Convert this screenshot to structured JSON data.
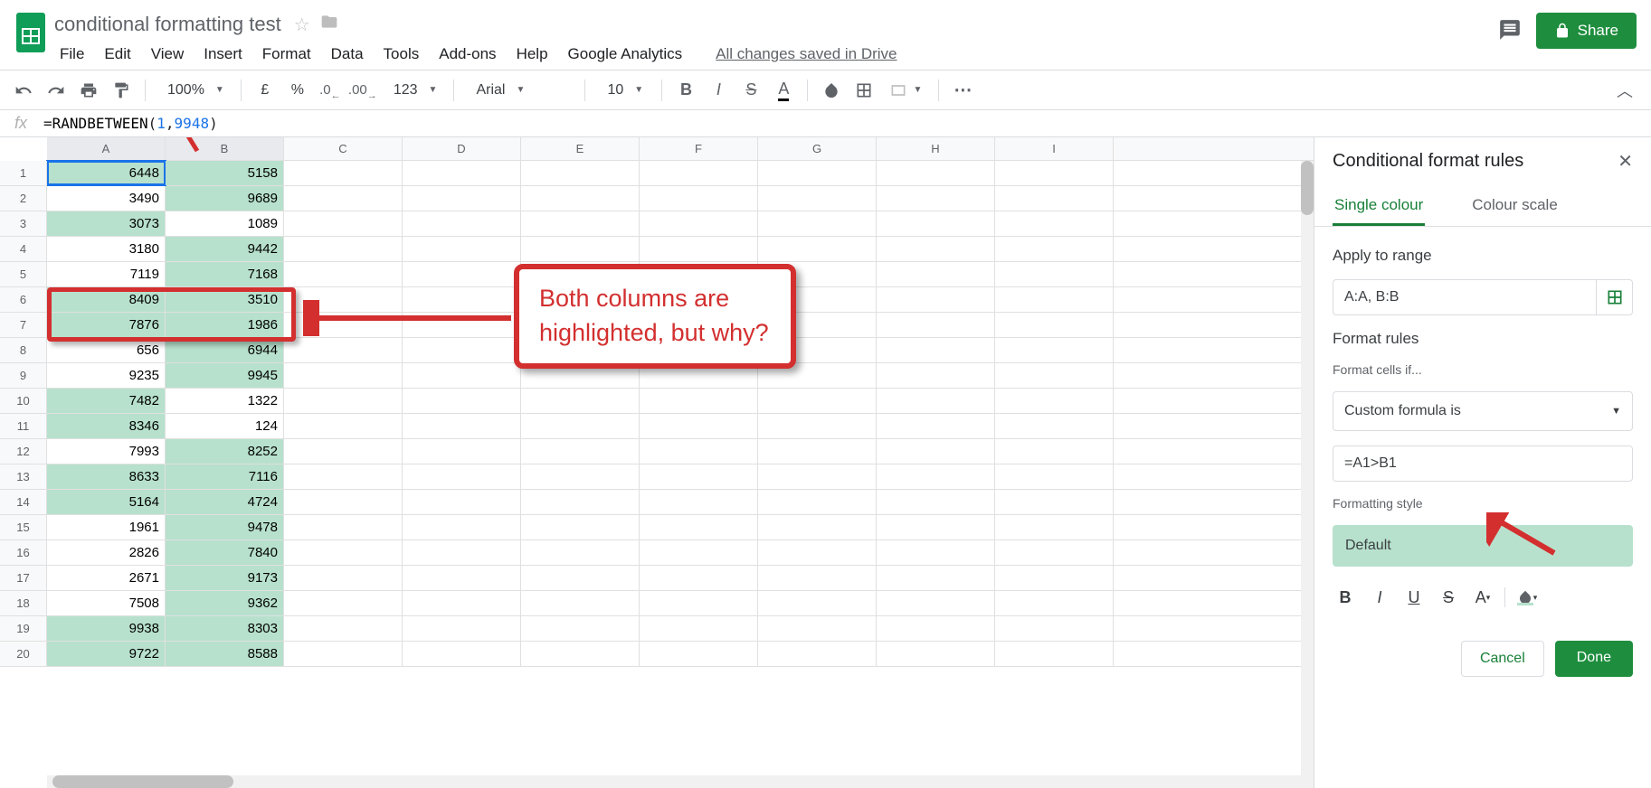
{
  "header": {
    "doc_title": "conditional formatting test",
    "share_label": "Share",
    "saved_label": "All changes saved in Drive"
  },
  "menubar": [
    "File",
    "Edit",
    "View",
    "Insert",
    "Format",
    "Data",
    "Tools",
    "Add-ons",
    "Help",
    "Google Analytics"
  ],
  "toolbar": {
    "zoom": "100%",
    "currency": "£",
    "percent": "%",
    "dec_dec": ".0",
    "dec_inc": ".00",
    "numfmt": "123",
    "font": "Arial",
    "size": "10"
  },
  "formula": {
    "fn": "RANDBETWEEN",
    "arg1": "1",
    "arg2": "9948"
  },
  "columns": [
    "A",
    "B",
    "C",
    "D",
    "E",
    "F",
    "G",
    "H",
    "I"
  ],
  "rows": [
    {
      "n": 1,
      "a": 6448,
      "b": 5158,
      "ha": true,
      "hb": true,
      "active": true
    },
    {
      "n": 2,
      "a": 3490,
      "b": 9689,
      "ha": false,
      "hb": true
    },
    {
      "n": 3,
      "a": 3073,
      "b": 1089,
      "ha": true,
      "hb": false
    },
    {
      "n": 4,
      "a": 3180,
      "b": 9442,
      "ha": false,
      "hb": true
    },
    {
      "n": 5,
      "a": 7119,
      "b": 7168,
      "ha": false,
      "hb": true
    },
    {
      "n": 6,
      "a": 8409,
      "b": 3510,
      "ha": true,
      "hb": true
    },
    {
      "n": 7,
      "a": 7876,
      "b": 1986,
      "ha": true,
      "hb": true
    },
    {
      "n": 8,
      "a": 656,
      "b": 6944,
      "ha": false,
      "hb": true
    },
    {
      "n": 9,
      "a": 9235,
      "b": 9945,
      "ha": false,
      "hb": true
    },
    {
      "n": 10,
      "a": 7482,
      "b": 1322,
      "ha": true,
      "hb": false
    },
    {
      "n": 11,
      "a": 8346,
      "b": 124,
      "ha": true,
      "hb": false
    },
    {
      "n": 12,
      "a": 7993,
      "b": 8252,
      "ha": false,
      "hb": true
    },
    {
      "n": 13,
      "a": 8633,
      "b": 7116,
      "ha": true,
      "hb": true
    },
    {
      "n": 14,
      "a": 5164,
      "b": 4724,
      "ha": true,
      "hb": true
    },
    {
      "n": 15,
      "a": 1961,
      "b": 9478,
      "ha": false,
      "hb": true
    },
    {
      "n": 16,
      "a": 2826,
      "b": 7840,
      "ha": false,
      "hb": true
    },
    {
      "n": 17,
      "a": 2671,
      "b": 9173,
      "ha": false,
      "hb": true
    },
    {
      "n": 18,
      "a": 7508,
      "b": 9362,
      "ha": false,
      "hb": true
    },
    {
      "n": 19,
      "a": 9938,
      "b": 8303,
      "ha": true,
      "hb": true
    },
    {
      "n": 20,
      "a": 9722,
      "b": 8588,
      "ha": true,
      "hb": true
    }
  ],
  "annotation": {
    "text": "Both columns are highlighted, but why?"
  },
  "sidebar": {
    "title": "Conditional format rules",
    "tab1": "Single colour",
    "tab2": "Colour scale",
    "apply_label": "Apply to range",
    "range_value": "A:A, B:B",
    "rules_label": "Format rules",
    "condition_label": "Format cells if...",
    "condition_value": "Custom formula is",
    "formula_value": "=A1>B1",
    "style_label": "Formatting style",
    "style_preview": "Default",
    "cancel": "Cancel",
    "done": "Done"
  }
}
